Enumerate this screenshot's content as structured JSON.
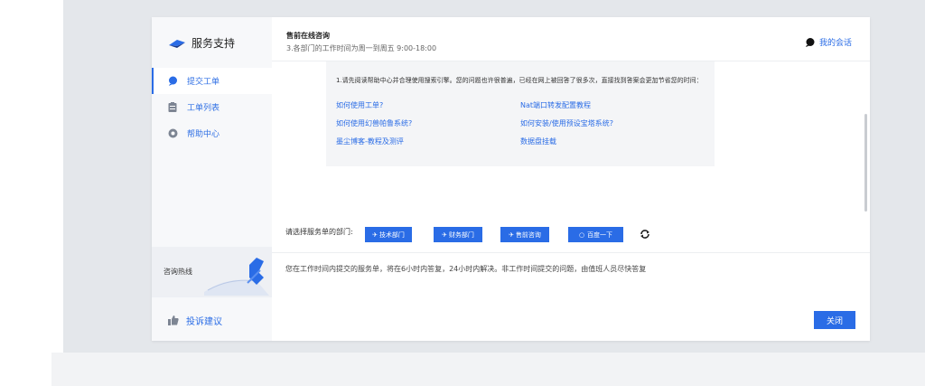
{
  "sidebar": {
    "logo_text": "服务支持",
    "items": [
      {
        "label": "提交工单",
        "icon": "chat-bubble-icon",
        "active": true
      },
      {
        "label": "工单列表",
        "icon": "clipboard-icon",
        "active": false
      },
      {
        "label": "帮助中心",
        "icon": "help-circle-icon",
        "active": false
      }
    ],
    "hotline_label": "咨询热线",
    "complaint_label": "投诉建议"
  },
  "header": {
    "title": "售前在线咨询",
    "subtitle": "3.各部门的工作时间为周一到周五 9:00-18:00",
    "my_chat_label": "我的会话"
  },
  "help_card": {
    "intro": "1.请先阅读帮助中心并合理使用搜索引擎。您的问题也许很普遍，已经在网上被回答了很多次，直接找到答案会更加节省您的时间：",
    "links": [
      "如何使用工单?",
      "Nat端口转发配置教程",
      "如何使用幻兽帕鲁系统?",
      "如何安装/使用预设宝塔系统?",
      "墨尘博客-教程及测评",
      "数据盘挂载"
    ]
  },
  "department": {
    "prompt": "请选择服务单的部门:",
    "buttons": [
      "技术部门",
      "财务部门",
      "售前咨询",
      "百度一下"
    ]
  },
  "notice": "您在工作时间内提交的服务单，将在6小时内答复，24小时内解决。非工作时间提交的问题，由值班人员尽快答复",
  "close_label": "关闭",
  "colors": {
    "accent": "#2a6ce6",
    "backdrop": "#e4e7eb",
    "sidebar": "#f7f8fa"
  }
}
